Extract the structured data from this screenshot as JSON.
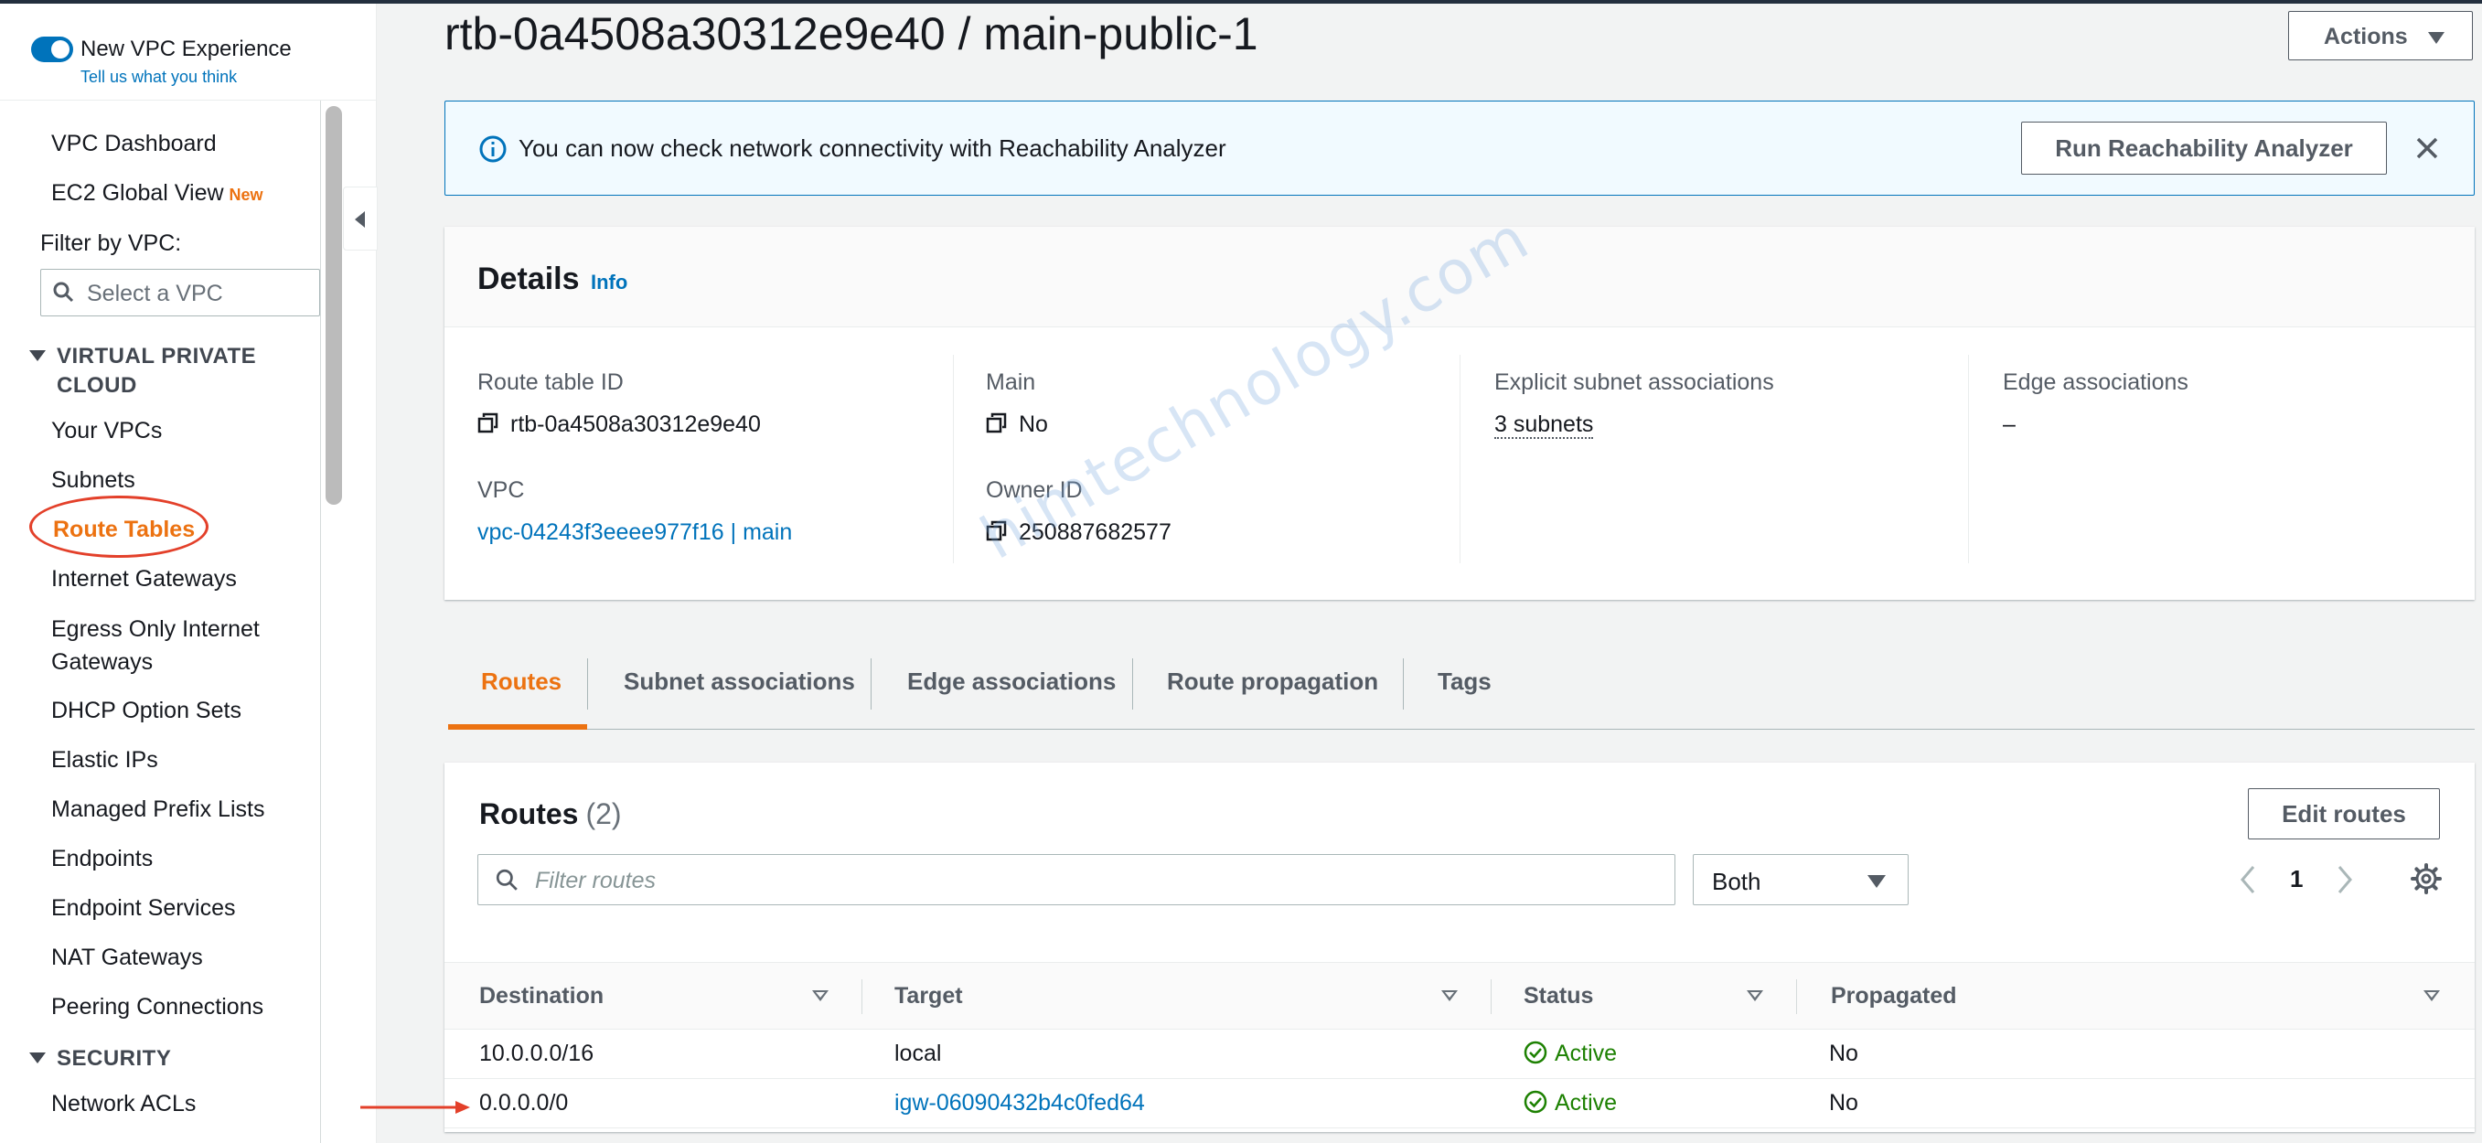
{
  "sidebar": {
    "experience_label": "New VPC Experience",
    "feedback_link": "Tell us what you think",
    "items": [
      {
        "label": "VPC Dashboard"
      },
      {
        "label": "EC2 Global View",
        "badge": "New"
      }
    ],
    "filter_label": "Filter by VPC:",
    "vpc_select_placeholder": "Select a VPC",
    "sections": [
      {
        "title": "VIRTUAL PRIVATE CLOUD"
      },
      {
        "title": "SECURITY"
      }
    ],
    "vpc_items": [
      "Your VPCs",
      "Subnets",
      "Route Tables",
      "Internet Gateways",
      "Egress Only Internet Gateways",
      "DHCP Option Sets",
      "Elastic IPs",
      "Managed Prefix Lists",
      "Endpoints",
      "Endpoint Services",
      "NAT Gateways",
      "Peering Connections"
    ],
    "security_items": [
      "Network ACLs"
    ],
    "active_item": "Route Tables"
  },
  "page": {
    "title": "rtb-0a4508a30312e9e40 / main-public-1",
    "actions_label": "Actions"
  },
  "flash": {
    "message": "You can now check network connectivity with Reachability Analyzer",
    "button_label": "Run Reachability Analyzer"
  },
  "details": {
    "title": "Details",
    "info_link": "Info",
    "fields": {
      "route_table_id": {
        "label": "Route table ID",
        "value": "rtb-0a4508a30312e9e40"
      },
      "vpc": {
        "label": "VPC",
        "value": "vpc-04243f3eeee977f16 | main"
      },
      "main": {
        "label": "Main",
        "value": "No"
      },
      "owner_id": {
        "label": "Owner ID",
        "value": "250887682577"
      },
      "explicit_subnet": {
        "label": "Explicit subnet associations",
        "value": "3 subnets"
      },
      "edge": {
        "label": "Edge associations",
        "value": "–"
      }
    }
  },
  "tabs": [
    "Routes",
    "Subnet associations",
    "Edge associations",
    "Route propagation",
    "Tags"
  ],
  "active_tab": "Routes",
  "routes": {
    "title": "Routes",
    "count": "(2)",
    "edit_label": "Edit routes",
    "filter_placeholder": "Filter routes",
    "select_value": "Both",
    "page_number": "1",
    "columns": [
      "Destination",
      "Target",
      "Status",
      "Propagated"
    ],
    "rows": [
      {
        "destination": "10.0.0.0/16",
        "target": "local",
        "target_is_link": false,
        "status": "Active",
        "propagated": "No"
      },
      {
        "destination": "0.0.0.0/0",
        "target": "igw-06090432b4c0fed64",
        "target_is_link": true,
        "status": "Active",
        "propagated": "No"
      }
    ]
  },
  "watermark": "himtechnology.com",
  "colors": {
    "accent": "#ec7211",
    "link": "#0073bb",
    "status_ok": "#1d8102",
    "annotation": "#e3402a"
  }
}
